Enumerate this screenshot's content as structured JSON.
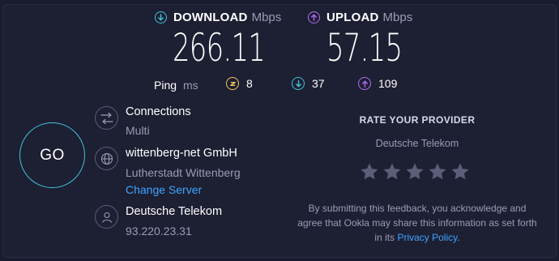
{
  "download": {
    "label": "DOWNLOAD",
    "unit": "Mbps",
    "value": "266.11",
    "icon": "download-arrow-icon",
    "color": "#3fc3d8"
  },
  "upload": {
    "label": "UPLOAD",
    "unit": "Mbps",
    "value": "57.15",
    "icon": "upload-arrow-icon",
    "color": "#b46cf0"
  },
  "ping": {
    "label": "Ping",
    "unit": "ms",
    "idle": {
      "value": "8",
      "icon": "idle-latency-icon",
      "color": "#f0c85a"
    },
    "download": {
      "value": "37",
      "icon": "download-latency-icon",
      "color": "#3fc3d8"
    },
    "upload": {
      "value": "109",
      "icon": "upload-latency-icon",
      "color": "#b46cf0"
    }
  },
  "go_button": {
    "label": "GO"
  },
  "connections": {
    "title": "Connections",
    "value": "Multi",
    "icon": "connections-icon"
  },
  "server": {
    "title": "wittenberg-net GmbH",
    "location": "Lutherstadt Wittenberg",
    "change_label": "Change Server",
    "icon": "globe-icon"
  },
  "provider": {
    "title": "Deutsche Telekom",
    "ip": "93.220.23.31",
    "icon": "user-icon"
  },
  "rating": {
    "title": "RATE YOUR PROVIDER",
    "provider": "Deutsche Telekom",
    "stars_total": 5,
    "stars_selected": 0,
    "disclaimer_before": "By submitting this feedback, you acknowledge and agree that Ookla may share this information as set forth in its ",
    "privacy_link": "Privacy Policy",
    "disclaimer_after": "."
  }
}
